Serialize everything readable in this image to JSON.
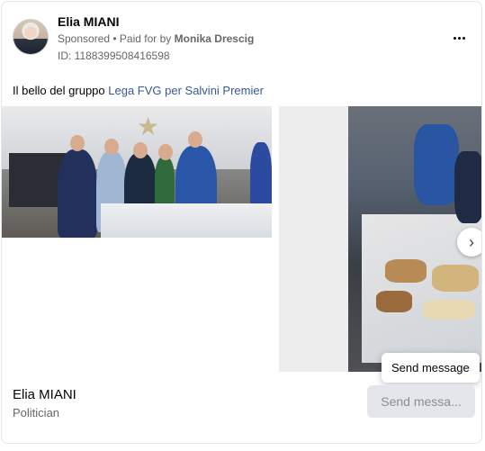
{
  "ad": {
    "page_name": "Elia MIANI",
    "sponsored": "Sponsored",
    "paid_for_prefix": " • Paid for by ",
    "paid_by": "Monika Drescig",
    "id_label": "ID: 1188399508416598",
    "body_text": "Il bello del gruppo ",
    "body_link": "Lega FVG per Salvini Premier"
  },
  "carousel": {
    "next_icon": "chevron-right-icon",
    "tooltip": "Send message"
  },
  "footer": {
    "name": "Elia MIANI",
    "category": "Politician",
    "cta_label": "Send messa..."
  },
  "icons": {
    "more": "more-horizontal-icon"
  }
}
